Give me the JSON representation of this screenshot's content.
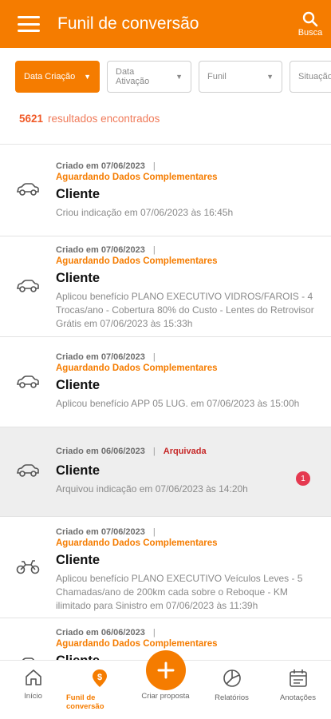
{
  "appbar": {
    "title": "Funil de conversão",
    "search_label": "Busca"
  },
  "filters": [
    {
      "label": "Data Criação",
      "active": true
    },
    {
      "label": "Data Ativação",
      "active": false
    },
    {
      "label": "Funil",
      "active": false
    },
    {
      "label": "Situação",
      "active": false
    }
  ],
  "results": {
    "count": "5621",
    "label": "resultados encontrados"
  },
  "items": [
    {
      "created": "Criado em 07/06/2023",
      "separator": "|",
      "status": "Aguardando Dados Complementares",
      "name": "Cliente",
      "description": "Criou indicação em 07/06/2023 às 16:45h",
      "icon": "car-icon"
    },
    {
      "created": "Criado em 07/06/2023",
      "separator": "|",
      "status": "Aguardando Dados Complementares",
      "name": "Cliente",
      "description": "Aplicou benefício PLANO EXECUTIVO VIDROS/FAROIS - 4 Trocas/ano - Cobertura 80% do Custo - Lentes do Retrovisor Grátis em 07/06/2023 às 15:33h",
      "icon": "car-icon"
    },
    {
      "created": "Criado em 07/06/2023",
      "separator": "|",
      "status": "Aguardando Dados Complementares",
      "name": "Cliente",
      "description": "Aplicou benefício APP 05 LUG. em 07/06/2023 às 15:00h",
      "icon": "car-icon"
    },
    {
      "created": "Criado em 06/06/2023",
      "separator": "|",
      "archived_label": "Arquivada",
      "name": "Cliente",
      "description": "Arquivou indicação em 07/06/2023 às 14:20h",
      "badge": "1",
      "icon": "car-icon"
    },
    {
      "created": "Criado em 07/06/2023",
      "separator": "|",
      "status": "Aguardando Dados Complementares",
      "name": "Cliente",
      "description": "Aplicou benefício PLANO EXECUTIVO Veículos Leves - 5 Chamadas/ano de 200km cada sobre o Reboque - KM ilimitado para Sinistro em 07/06/2023 às 11:39h",
      "icon": "motorcycle-icon"
    },
    {
      "created": "Criado em 06/06/2023",
      "separator": "|",
      "status": "Aguardando Dados Complementares",
      "name": "Cliente",
      "description": "",
      "icon": "car-icon"
    }
  ],
  "bottomnav": {
    "home": "Início",
    "funnel": "Funil de conversão",
    "create": "Criar proposta",
    "reports": "Relatórios",
    "notes": "Anotações"
  },
  "colors": {
    "primary": "#f57c00",
    "count": "#f05a28",
    "archived": "#c62828",
    "badge": "#e53950"
  }
}
